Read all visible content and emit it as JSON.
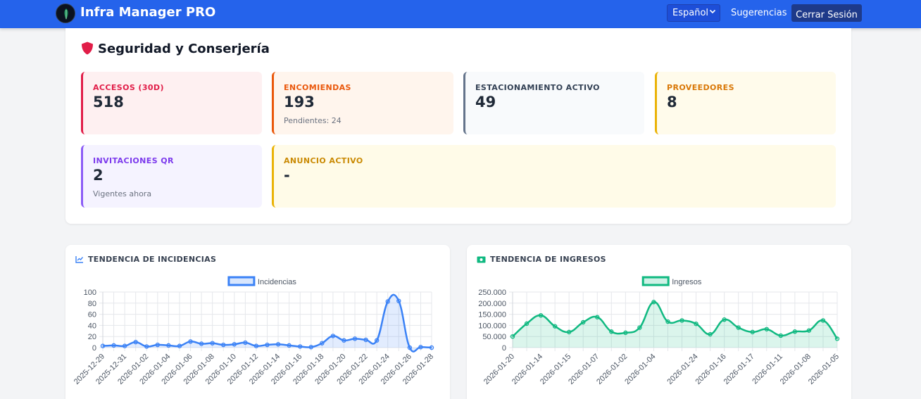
{
  "app": {
    "title": "Infra Manager PRO",
    "accent": "#2563eb"
  },
  "nav": {
    "language": "Español",
    "suggestions": "Sugerencias",
    "logout": "Cerrar Sesión"
  },
  "security": {
    "title": "Seguridad y Conserjería",
    "icon": "shield-icon",
    "stats": {
      "accesos": {
        "label": "ACCESOS (30D)",
        "value": "518",
        "color": "#e11d48"
      },
      "encomiendas": {
        "label": "ENCOMIENDAS",
        "value": "193",
        "sub": "Pendientes: 24",
        "color": "#ea580c"
      },
      "estacionamiento": {
        "label": "ESTACIONAMIENTO ACTIVO",
        "value": "49",
        "color": "#64748b"
      },
      "proveedores": {
        "label": "PROVEEDORES",
        "value": "8",
        "color": "#eab308"
      },
      "invitaciones": {
        "label": "INVITACIONES QR",
        "value": "2",
        "sub": "Vigentes ahora",
        "color": "#8b5cf6"
      },
      "anuncio": {
        "label": "ANUNCIO ACTIVO",
        "value": "-",
        "color": "#eab308"
      }
    }
  },
  "charts": {
    "incidencias_title": "TENDENCIA DE INCIDENCIAS",
    "ingresos_title": "TENDENCIA DE INGRESOS"
  },
  "chart_data": [
    {
      "type": "area",
      "id": "incidencias",
      "color": "#3b82f6",
      "ylim": [
        0,
        100
      ],
      "yticks": [
        "0",
        "20",
        "40",
        "60",
        "80",
        "100"
      ],
      "x": [
        "2025-12-29",
        "2025-12-30",
        "2025-12-31",
        "2026-01-01",
        "2026-01-02",
        "2026-01-03",
        "2026-01-04",
        "2026-01-05",
        "2026-01-06",
        "2026-01-07",
        "2026-01-08",
        "2026-01-09",
        "2026-01-10",
        "2026-01-11",
        "2026-01-12",
        "2026-01-13",
        "2026-01-14",
        "2026-01-15",
        "2026-01-16",
        "2026-01-17",
        "2026-01-18",
        "2026-01-19",
        "2026-01-20",
        "2026-01-21",
        "2026-01-22",
        "2026-01-23",
        "2026-01-24",
        "2026-01-25",
        "2026-01-26",
        "2026-01-27",
        "2026-01-28"
      ],
      "xtick_labels": [
        "2025-12-29",
        "2025-12-31",
        "2026-01-02",
        "2026-01-04",
        "2026-01-06",
        "2026-01-08",
        "2026-01-10",
        "2026-01-12",
        "2026-01-14",
        "2026-01-16",
        "2026-01-18",
        "2026-01-20",
        "2026-01-22",
        "2026-01-24",
        "2026-01-26",
        "2026-01-28"
      ],
      "series": [
        {
          "name": "Incidencias",
          "values": [
            3,
            4,
            3,
            10,
            2,
            5,
            4,
            3,
            11,
            7,
            8,
            5,
            6,
            9,
            3,
            5,
            6,
            4,
            2,
            1,
            8,
            21,
            13,
            16,
            14,
            13,
            83,
            84,
            0,
            1,
            0
          ]
        }
      ],
      "legend": "top",
      "grid": true
    },
    {
      "type": "area",
      "id": "ingresos",
      "color": "#10b981",
      "ylim": [
        0,
        250000
      ],
      "yticks": [
        "0",
        "50.000",
        "100.000",
        "150.000",
        "200.000",
        "250.000"
      ],
      "x": [
        "2026-01-20",
        "2026-01-18",
        "2026-01-14",
        "2026-01-13",
        "2026-01-15",
        "2026-01-09",
        "2026-01-07",
        "2026-01-06",
        "2026-01-02",
        "2026-01-03",
        "2026-01-04",
        "2026-01-10",
        "2026-01-24",
        "2026-01-12",
        "2026-01-16",
        "2026-01-19",
        "2026-01-17",
        "2026-01-21",
        "2026-01-11",
        "2026-01-22",
        "2026-01-08",
        "2026-01-23",
        "2026-01-05",
        "2026-01-25"
      ],
      "xtick_labels": [
        "2026-01-20",
        "2026-01-14",
        "2026-01-15",
        "2026-01-07",
        "2026-01-02",
        "2026-01-04",
        "2026-01-24",
        "2026-01-16",
        "2026-01-17",
        "2026-01-11",
        "2026-01-08",
        "2026-01-05"
      ],
      "series": [
        {
          "name": "Ingresos",
          "values": [
            50000,
            108000,
            145000,
            96000,
            70000,
            114000,
            137000,
            72000,
            67000,
            90000,
            205000,
            117000,
            122000,
            107000,
            60000,
            126000,
            90000,
            70000,
            83000,
            54000,
            72000,
            77000,
            122000,
            40000
          ]
        }
      ],
      "legend": "top",
      "grid": true
    }
  ]
}
